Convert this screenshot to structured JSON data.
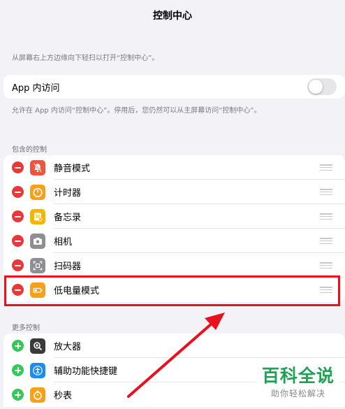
{
  "header": {
    "title": "控制中心"
  },
  "hints": {
    "swipe": "从屏幕右上方边缘向下轻扫以打开“控制中心”。",
    "app_access": "允许在 App 内访问“控制中心”。停用后，您仍然可以从主屏幕访问“控制中心”。"
  },
  "app_access": {
    "label": "App 内访问",
    "enabled": false
  },
  "included": {
    "label": "包含的控制",
    "items": [
      {
        "name": "静音模式",
        "icon": "bell-slash-icon",
        "color": "#f0533e"
      },
      {
        "name": "计时器",
        "icon": "timer-icon",
        "color": "#f7a11b"
      },
      {
        "name": "备忘录",
        "icon": "notes-icon",
        "color": "#f7b500"
      },
      {
        "name": "相机",
        "icon": "camera-icon",
        "color": "#8e8e93"
      },
      {
        "name": "扫码器",
        "icon": "qr-scanner-icon",
        "color": "#8e8e93"
      },
      {
        "name": "低电量模式",
        "icon": "battery-icon",
        "color": "#f7a11b"
      }
    ]
  },
  "more": {
    "label": "更多控制",
    "items": [
      {
        "name": "放大器",
        "icon": "magnifier-icon",
        "color": "#3a3a3c"
      },
      {
        "name": "辅助功能快捷键",
        "icon": "accessibility-icon",
        "color": "#1a8cf2"
      },
      {
        "name": "秒表",
        "icon": "stopwatch-icon",
        "color": "#f7a11b"
      }
    ]
  },
  "watermark": {
    "logo": "百科全说",
    "sub": "助你轻松解决"
  },
  "colors": {
    "remove": "#e8383a",
    "add": "#34c759",
    "highlight": "#e8111d",
    "background": "#f2f2f7"
  }
}
